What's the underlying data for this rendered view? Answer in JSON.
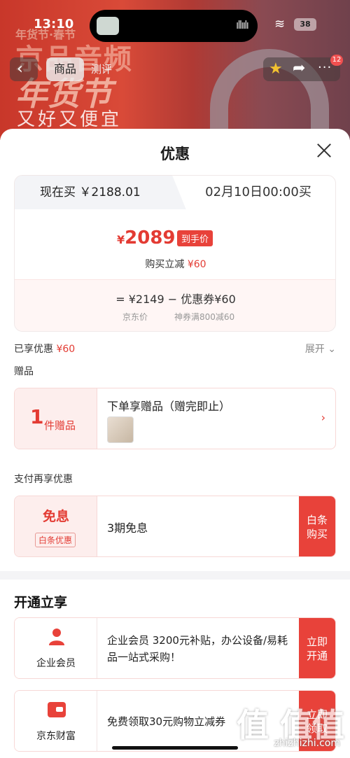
{
  "status_bar": {
    "time": "13:10",
    "battery": "38"
  },
  "background": {
    "banner_line1": "年货节·春节",
    "banner_line2": "京品音频",
    "banner_line3": "年货节",
    "banner_line4": "又好又便宜",
    "tab_active": "商品",
    "tab_inactive": "测评",
    "badge_count": "12"
  },
  "sheet": {
    "title": "优惠",
    "price_tabs": {
      "now": "现在买 ￥2188.01",
      "later": "02月10日00:00买"
    },
    "final_price": {
      "currency": "¥",
      "amount": "2089",
      "tag": "到手价"
    },
    "instant_cut": {
      "label": "购买立减",
      "value": "¥60"
    },
    "breakdown": {
      "line": "=  ¥2149  −  优惠券¥60",
      "sub_left": "京东价",
      "sub_right": "神券满800减60"
    },
    "enjoyed": {
      "label": "已享优惠",
      "value": "¥60",
      "expand": "展开"
    },
    "gift_section": {
      "label": "赠品",
      "count": "1",
      "unit": "件赠品",
      "title": "下单享赠品（赠完即止）"
    },
    "pay_section": {
      "label": "支付再享优惠",
      "free_title": "免息",
      "tag": "白条优惠",
      "text": "3期免息",
      "button_line1": "白条",
      "button_line2": "购买"
    },
    "open_section": {
      "title": "开通立享",
      "items": [
        {
          "name": "企业会员",
          "text": "企业会员 3200元补贴，办公设备/易耗品一站式采购！",
          "btn1": "立即",
          "btn2": "开通",
          "icon": "person-icon"
        },
        {
          "name": "京东财富",
          "text": "免费领取30元购物立减券",
          "btn1": "立即",
          "btn2": "领取",
          "icon": "wallet-icon"
        }
      ]
    }
  },
  "watermark": {
    "logo": "值 值值",
    "url": "zhizhizhi.com"
  },
  "colors": {
    "accent": "#e8423a",
    "price_red": "#e33b33",
    "tint": "#fdeeed"
  }
}
